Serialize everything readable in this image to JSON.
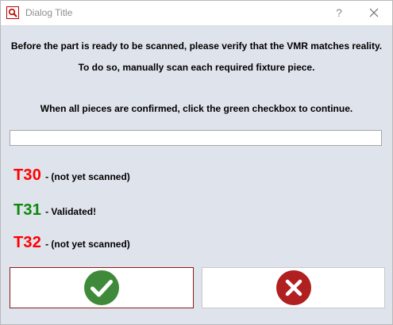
{
  "window": {
    "title": "Dialog Title",
    "help_label": "?"
  },
  "instructions": {
    "line1": "Before the part is ready to be scanned, please verify that the VMR matches reality.",
    "line2": "To do so, manually scan each required fixture piece.",
    "line3": "When all pieces are confirmed, click the green checkbox to continue."
  },
  "scan_input": {
    "value": "",
    "placeholder": ""
  },
  "fixtures": [
    {
      "code": "T30",
      "separator": " - ",
      "status": "(not yet scanned)",
      "color": "#ff0000"
    },
    {
      "code": "T31",
      "separator": " - ",
      "status": "Validated!",
      "color": "#0c8a0c"
    },
    {
      "code": "T32",
      "separator": " - ",
      "status": "(not yet scanned)",
      "color": "#ff0000"
    }
  ],
  "buttons": {
    "confirm_icon": "check-circle-icon",
    "cancel_icon": "x-circle-icon",
    "confirm_color": "#3f8a3a",
    "cancel_color": "#b02020"
  }
}
